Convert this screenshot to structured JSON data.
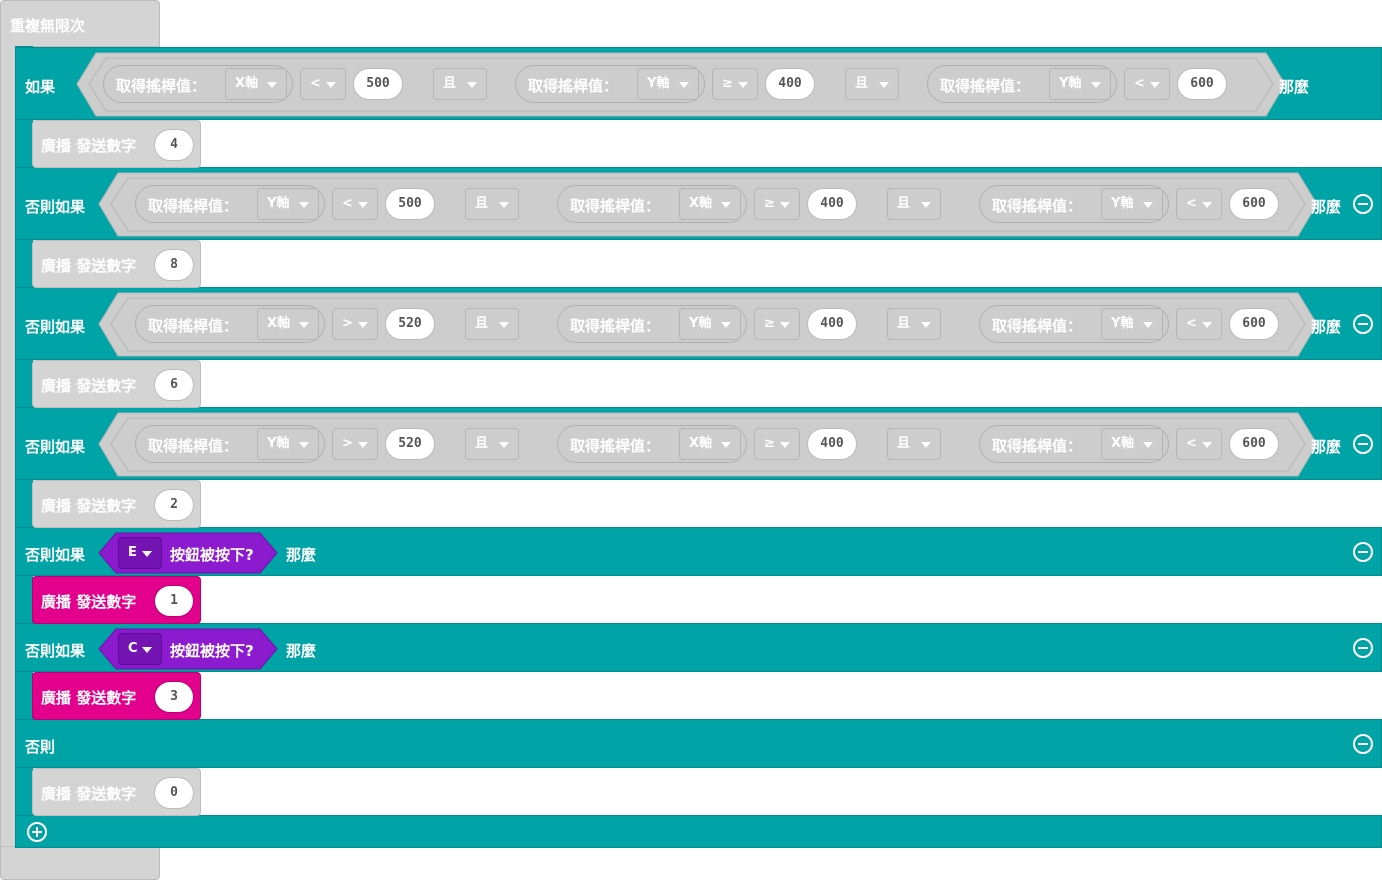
{
  "forever": {
    "label": "重複無限次"
  },
  "if_block": {
    "then_label": "那麼",
    "branches": [
      {
        "label": "如果",
        "conds": [
          {
            "getter": "取得搖桿值：",
            "axis": "X軸",
            "op": "<",
            "value": "500"
          },
          {
            "getter": "取得搖桿值：",
            "axis": "Y軸",
            "op": "≥",
            "value": "400"
          },
          {
            "getter": "取得搖桿值：",
            "axis": "Y軸",
            "op": "<",
            "value": "600"
          }
        ],
        "joins": [
          "且",
          "且"
        ]
      },
      {
        "label": "否則如果",
        "conds": [
          {
            "getter": "取得搖桿值：",
            "axis": "Y軸",
            "op": "<",
            "value": "500"
          },
          {
            "getter": "取得搖桿值：",
            "axis": "X軸",
            "op": "≥",
            "value": "400"
          },
          {
            "getter": "取得搖桿值：",
            "axis": "Y軸",
            "op": "<",
            "value": "600"
          }
        ],
        "joins": [
          "且",
          "且"
        ]
      },
      {
        "label": "否則如果",
        "conds": [
          {
            "getter": "取得搖桿值：",
            "axis": "X軸",
            "op": ">",
            "value": "520"
          },
          {
            "getter": "取得搖桿值：",
            "axis": "Y軸",
            "op": "≥",
            "value": "400"
          },
          {
            "getter": "取得搖桿值：",
            "axis": "Y軸",
            "op": "<",
            "value": "600"
          }
        ],
        "joins": [
          "且",
          "且"
        ]
      },
      {
        "label": "否則如果",
        "conds": [
          {
            "getter": "取得搖桿值：",
            "axis": "Y軸",
            "op": ">",
            "value": "520"
          },
          {
            "getter": "取得搖桿值：",
            "axis": "X軸",
            "op": "≥",
            "value": "400"
          },
          {
            "getter": "取得搖桿值：",
            "axis": "X軸",
            "op": "<",
            "value": "600"
          }
        ],
        "joins": [
          "且",
          "且"
        ]
      },
      {
        "label": "否則如果",
        "button": {
          "key": "E",
          "text": "按鈕被按下?"
        }
      },
      {
        "label": "否則如果",
        "button": {
          "key": "C",
          "text": "按鈕被按下?"
        }
      },
      {
        "label": "否則"
      }
    ]
  },
  "broadcasts": [
    {
      "label": "廣播 發送數字",
      "value": "4",
      "state": "disabled"
    },
    {
      "label": "廣播 發送數字",
      "value": "8",
      "state": "disabled"
    },
    {
      "label": "廣播 發送數字",
      "value": "6",
      "state": "disabled"
    },
    {
      "label": "廣播 發送數字",
      "value": "2",
      "state": "disabled"
    },
    {
      "label": "廣播 發送數字",
      "value": "1",
      "state": "enabled"
    },
    {
      "label": "廣播 發送數字",
      "value": "3",
      "state": "enabled"
    },
    {
      "label": "廣播 發送數字",
      "value": "0",
      "state": "disabled"
    }
  ],
  "colors": {
    "logic": "#00a4a6",
    "radio": "#e3008c",
    "input": "#8c1bcf",
    "disabled": "#d4d4d4"
  }
}
